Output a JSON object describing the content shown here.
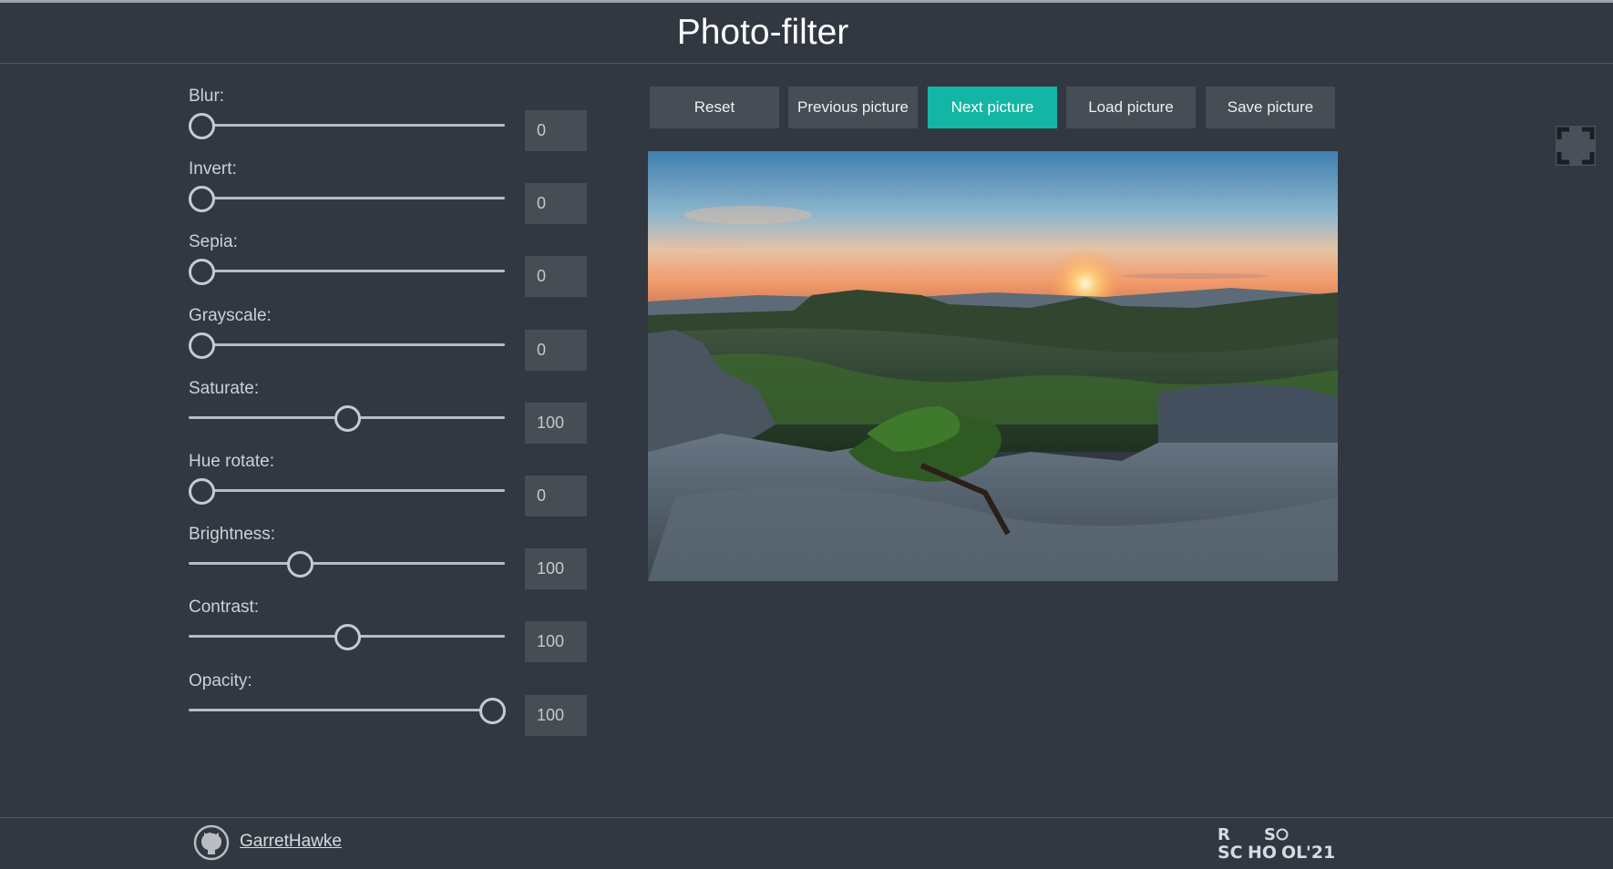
{
  "header": {
    "title": "Photo-filter"
  },
  "filters": [
    {
      "label": "Blur:",
      "value": "0",
      "fraction": 0
    },
    {
      "label": "Invert:",
      "value": "0",
      "fraction": 0
    },
    {
      "label": "Sepia:",
      "value": "0",
      "fraction": 0
    },
    {
      "label": "Grayscale:",
      "value": "0",
      "fraction": 0
    },
    {
      "label": "Saturate:",
      "value": "100",
      "fraction": 0.5
    },
    {
      "label": "Hue rotate:",
      "value": "0",
      "fraction": 0
    },
    {
      "label": "Brightness:",
      "value": "100",
      "fraction": 0.34
    },
    {
      "label": "Contrast:",
      "value": "100",
      "fraction": 0.5
    },
    {
      "label": "Opacity:",
      "value": "100",
      "fraction": 1
    }
  ],
  "toolbar": {
    "reset": "Reset",
    "previous": "Previous picture",
    "next": "Next picture",
    "load": "Load picture",
    "save": "Save picture"
  },
  "colors": {
    "background": "#313841",
    "accent": "#13b5a4",
    "button": "#464d55"
  },
  "icons": {
    "fullscreen": "fullscreen-icon",
    "github": "github-icon"
  },
  "footer": {
    "author": "GarretHawke",
    "logo_text": [
      "R",
      "S",
      "SC",
      "HO",
      "OL",
      "'21"
    ]
  }
}
